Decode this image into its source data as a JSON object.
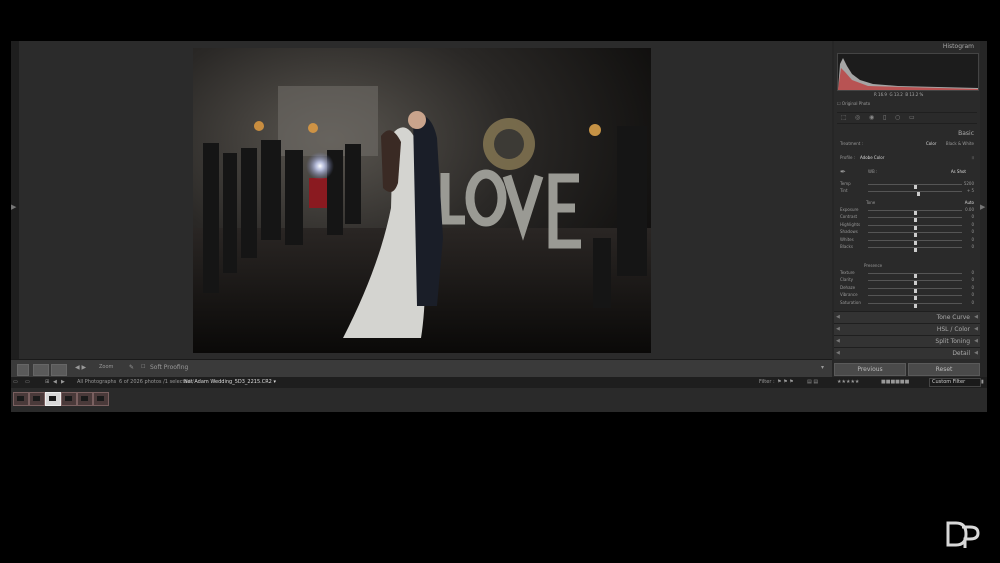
{
  "right_panel": {
    "histogram_title": "Histogram",
    "histogram_readout": [
      "R 16.9",
      "G 13.2",
      "B 13.2 %"
    ],
    "original_photo_label": "Original Photo",
    "basic_title": "Basic",
    "treatment_label": "Treatment :",
    "treatment_color": "Color",
    "treatment_bw": "Black & White",
    "profile_label": "Profile :",
    "profile_value": "Adobe Color",
    "wb_label": "WB :",
    "wb_value": "As Shot",
    "sliders_wb": [
      {
        "label": "Temp",
        "value": "5200",
        "pos": 0.5
      },
      {
        "label": "Tint",
        "value": "+ 5",
        "pos": 0.53
      }
    ],
    "tone_label": "Tone",
    "tone_auto": "Auto",
    "sliders_tone": [
      {
        "label": "Exposure",
        "value": "0.00",
        "pos": 0.5
      },
      {
        "label": "Contrast",
        "value": "0",
        "pos": 0.5
      },
      {
        "label": "Highlights",
        "value": "0",
        "pos": 0.5
      },
      {
        "label": "Shadows",
        "value": "0",
        "pos": 0.5
      },
      {
        "label": "Whites",
        "value": "0",
        "pos": 0.5
      },
      {
        "label": "Blacks",
        "value": "0",
        "pos": 0.5
      }
    ],
    "presence_label": "Presence",
    "sliders_presence": [
      {
        "label": "Texture",
        "value": "0",
        "pos": 0.5
      },
      {
        "label": "Clarity",
        "value": "0",
        "pos": 0.5
      },
      {
        "label": "Dehaze",
        "value": "0",
        "pos": 0.5
      },
      {
        "label": "Vibrance",
        "value": "0",
        "pos": 0.5
      },
      {
        "label": "Saturation",
        "value": "0",
        "pos": 0.5
      }
    ],
    "collapsed_sections": [
      "Tone Curve",
      "HSL / Color",
      "Split Toning",
      "Detail"
    ],
    "previous_button": "Previous",
    "reset_button": "Reset"
  },
  "toolbar": {
    "zoom_label": "Zoom",
    "soft_proofing_label": "Soft Proofing"
  },
  "filmstrip": {
    "source_label": "All Photographs",
    "status_text": "6 of 2026 photos /1 selected /",
    "filename": "Nat Adam Wedding_5D3_2215.CR2",
    "filter_label": "Filter :",
    "custom_filter": "Custom Filter"
  },
  "photo": {
    "sign_text": "LOVE"
  },
  "watermark": {
    "logo_text": "DP"
  }
}
